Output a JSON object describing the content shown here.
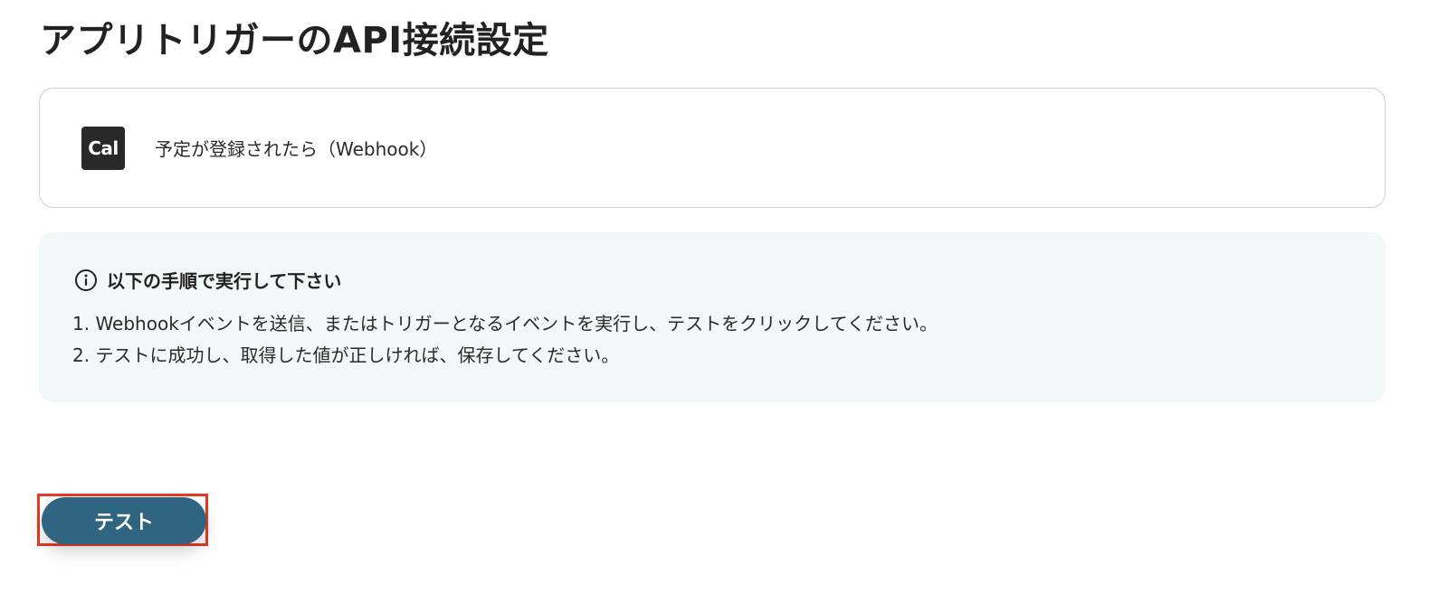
{
  "page": {
    "title": "アプリトリガーのAPI接続設定"
  },
  "trigger": {
    "app_logo_text": "Cal",
    "label": "予定が登録されたら（Webhook）"
  },
  "instructions": {
    "icon": "info-icon",
    "heading": "以下の手順で実行して下さい",
    "steps": [
      "1. Webhookイベントを送信、またはトリガーとなるイベントを実行し、テストをクリックしてください。",
      "2. テストに成功し、取得した値が正しければ、保存してください。"
    ]
  },
  "actions": {
    "test_label": "テスト"
  },
  "colors": {
    "button_bg": "#2f6580",
    "highlight_border": "#e53a23",
    "info_bg": "#f2f8f7",
    "logo_bg": "#292929"
  }
}
